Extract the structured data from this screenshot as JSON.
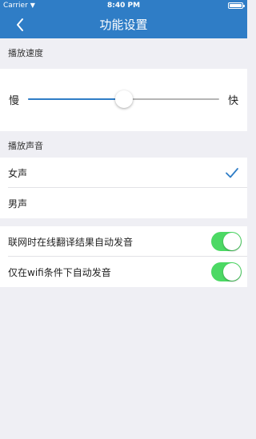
{
  "status_bar": {
    "carrier": "Carrier",
    "time": "8:40 PM",
    "battery_level": 1.0
  },
  "nav": {
    "title": "功能设置"
  },
  "speed": {
    "header": "播放速度",
    "slow_label": "慢",
    "fast_label": "快",
    "value": 0.5
  },
  "voice": {
    "header": "播放声音",
    "options": [
      {
        "label": "女声",
        "selected": true
      },
      {
        "label": "男声",
        "selected": false
      }
    ]
  },
  "toggles": [
    {
      "label": "联网时在线翻译结果自动发音",
      "on": true
    },
    {
      "label": "仅在wifi条件下自动发音",
      "on": true
    }
  ],
  "colors": {
    "accent": "#2f7dc6",
    "toggle_on": "#4cd964",
    "background": "#efeff4"
  }
}
